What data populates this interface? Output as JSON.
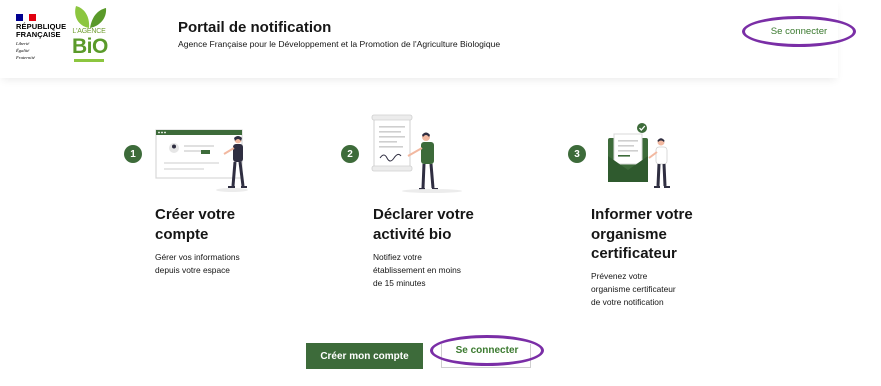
{
  "colors": {
    "primary_green": "#3d6b3a",
    "link_green": "#3b7a2f",
    "highlight_purple": "#7a2ea6",
    "flag_blue": "#000091",
    "flag_red": "#e1000f",
    "bio_green": "#5a9a2a"
  },
  "header": {
    "marianne": {
      "name_line1": "RÉPUBLIQUE",
      "name_line2": "FRANÇAISE",
      "motto_line1": "Liberté",
      "motto_line2": "Égalité",
      "motto_line3": "Fraternité"
    },
    "bio_logo": {
      "lagence": "L'AGENCE",
      "bio": "BiO"
    },
    "title": "Portail de notification",
    "subtitle": "Agence Française pour le Développement et la Promotion de l'Agriculture Biologique",
    "connect_label": "Se connecter"
  },
  "steps": [
    {
      "number": "1",
      "title_line1": "Créer votre",
      "title_line2": "compte",
      "desc_line1": "Gérer vos informations",
      "desc_line2": "depuis votre espace",
      "illustration": "account-creation-illustration"
    },
    {
      "number": "2",
      "title_line1": "Déclarer votre",
      "title_line2": "activité bio",
      "desc_line1": "Notifiez votre",
      "desc_line2": "établissement en moins",
      "desc_line3": "de 15 minutes",
      "illustration": "document-signing-illustration"
    },
    {
      "number": "3",
      "title_line1": "Informer votre",
      "title_line2": "organisme",
      "title_line3": "certificateur",
      "desc_line1": "Prévenez votre",
      "desc_line2": "organisme certificateur",
      "desc_line3": "de votre notification",
      "illustration": "mail-inbox-illustration"
    }
  ],
  "actions": {
    "create_account_label": "Créer mon compte",
    "connect_label": "Se connecter"
  }
}
